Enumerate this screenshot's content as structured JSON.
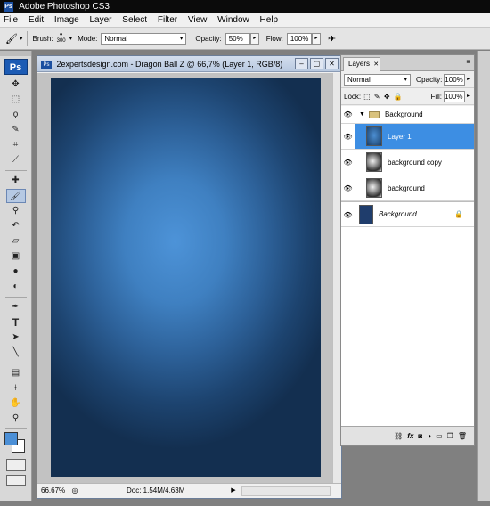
{
  "app": {
    "title": "Adobe Photoshop CS3",
    "logo_text": "Ps"
  },
  "menu": [
    "File",
    "Edit",
    "Image",
    "Layer",
    "Select",
    "Filter",
    "View",
    "Window",
    "Help"
  ],
  "options_bar": {
    "brush_label": "Brush:",
    "brush_size": "300",
    "mode_label": "Mode:",
    "mode_value": "Normal",
    "opacity_label": "Opacity:",
    "opacity_value": "50%",
    "flow_label": "Flow:",
    "flow_value": "100%"
  },
  "toolbox": {
    "tools": [
      {
        "name": "move-tool",
        "glyph": "✥"
      },
      {
        "name": "marquee-tool",
        "glyph": "⬚"
      },
      {
        "name": "lasso-tool",
        "glyph": "ϙ"
      },
      {
        "name": "quick-selection-tool",
        "glyph": "✎"
      },
      {
        "name": "crop-tool",
        "glyph": "⌗"
      },
      {
        "name": "slice-tool",
        "glyph": "⟋"
      },
      {
        "name": "healing-brush-tool",
        "glyph": "✚"
      },
      {
        "name": "brush-tool",
        "glyph": "🖌"
      },
      {
        "name": "clone-stamp-tool",
        "glyph": "⚲"
      },
      {
        "name": "history-brush-tool",
        "glyph": "↶"
      },
      {
        "name": "eraser-tool",
        "glyph": "▱"
      },
      {
        "name": "gradient-tool",
        "glyph": "▣"
      },
      {
        "name": "blur-tool",
        "glyph": "●"
      },
      {
        "name": "dodge-tool",
        "glyph": "◐"
      },
      {
        "name": "pen-tool",
        "glyph": "✒"
      },
      {
        "name": "type-tool",
        "glyph": "T"
      },
      {
        "name": "path-selection-tool",
        "glyph": "➤"
      },
      {
        "name": "line-tool",
        "glyph": "╲"
      },
      {
        "name": "notes-tool",
        "glyph": "▤"
      },
      {
        "name": "eyedropper-tool",
        "glyph": "⟊"
      },
      {
        "name": "hand-tool",
        "glyph": "✋"
      },
      {
        "name": "zoom-tool",
        "glyph": "⚲"
      }
    ],
    "foreground_color": "#4b8fd6",
    "background_color": "#ffffff"
  },
  "document": {
    "icon_text": "Ps",
    "title": "2expertsdesign.com - Dragon Ball Z @ 66,7% (Layer 1, RGB/8)",
    "zoom": "66.67%",
    "doc_size": "Doc: 1.54M/4.63M"
  },
  "layers_panel": {
    "tab_label": "Layers",
    "blend_mode": "Normal",
    "opacity_label": "Opacity:",
    "opacity_value": "100%",
    "lock_label": "Lock:",
    "fill_label": "Fill:",
    "fill_value": "100%",
    "layers": [
      {
        "name": "Background",
        "type": "group"
      },
      {
        "name": "Layer 1",
        "type": "layer",
        "selected": true
      },
      {
        "name": "background copy",
        "type": "layer"
      },
      {
        "name": "background",
        "type": "layer"
      },
      {
        "name": "Background",
        "type": "base",
        "locked": true
      }
    ]
  },
  "colors": {
    "canvas_center": "#4d93d8",
    "canvas_edge": "#132f50",
    "selection": "#3d8ee3"
  }
}
